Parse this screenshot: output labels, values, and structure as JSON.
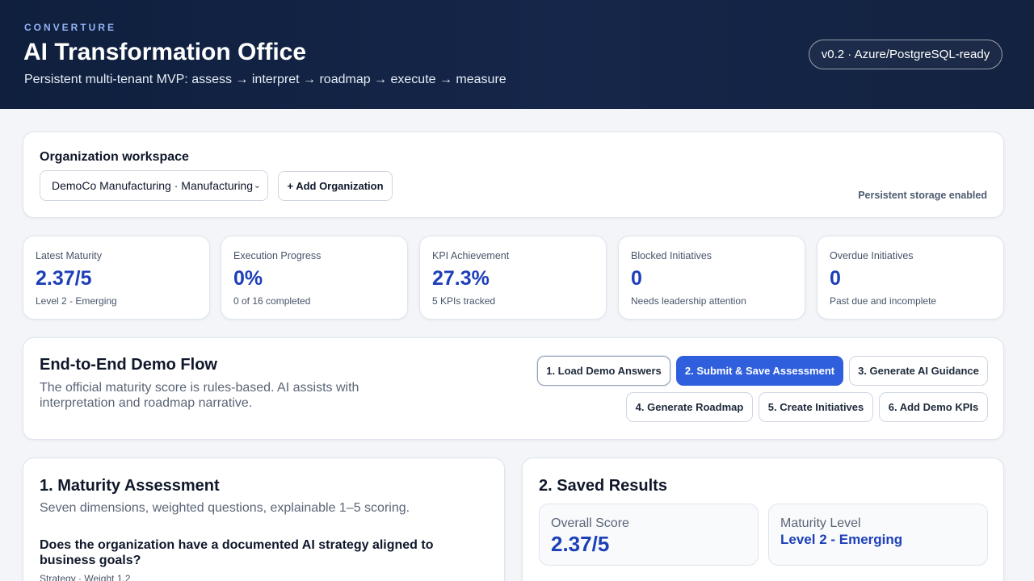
{
  "header": {
    "eyebrow": "CONVERTURE",
    "title": "AI Transformation Office",
    "subtitle": "Persistent multi-tenant MVP: assess → interpret → roadmap → execute → measure",
    "version": "v0.2 · Azure/PostgreSQL-ready"
  },
  "workspace": {
    "title": "Organization workspace",
    "selected_org": "DemoCo Manufacturing · Manufacturing",
    "add_button": "+ Add Organization",
    "storage_status": "Persistent storage enabled"
  },
  "stats": [
    {
      "label": "Latest Maturity",
      "value": "2.37/5",
      "note": "Level 2 - Emerging"
    },
    {
      "label": "Execution Progress",
      "value": "0%",
      "note": "0 of 16 completed"
    },
    {
      "label": "KPI Achievement",
      "value": "27.3%",
      "note": "5 KPIs tracked"
    },
    {
      "label": "Blocked Initiatives",
      "value": "0",
      "note": "Needs leadership attention"
    },
    {
      "label": "Overdue Initiatives",
      "value": "0",
      "note": "Past due and incomplete"
    }
  ],
  "flow": {
    "title": "End-to-End Demo Flow",
    "description": "The official maturity score is rules-based. AI assists with interpretation and roadmap narrative.",
    "steps": [
      "1. Load Demo Answers",
      "2. Submit & Save Assessment",
      "3. Generate AI Guidance",
      "4. Generate Roadmap",
      "5. Create Initiatives",
      "6. Add Demo KPIs"
    ]
  },
  "assessment": {
    "title": "1. Maturity Assessment",
    "subtitle": "Seven dimensions, weighted questions, explainable 1–5 scoring.",
    "question": "Does the organization have a documented AI strategy aligned to business goals?",
    "question_meta": "Strategy · Weight 1.2"
  },
  "results": {
    "title": "2. Saved Results",
    "overall_label": "Overall Score",
    "overall_value": "2.37/5",
    "level_label": "Maturity Level",
    "level_value": "Level 2 - Emerging"
  },
  "colors": {
    "header_bg": "#13223f",
    "accent": "#2f5fdc",
    "value_blue": "#1d3fb8"
  }
}
